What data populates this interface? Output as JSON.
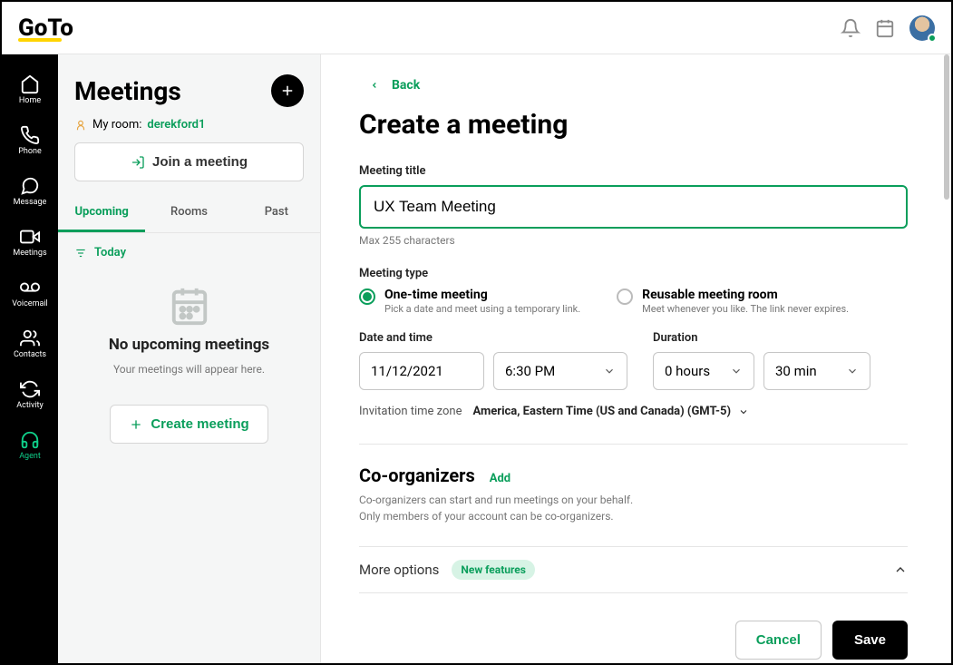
{
  "brand": "GoTo",
  "sidebar": [
    {
      "label": "Home"
    },
    {
      "label": "Phone"
    },
    {
      "label": "Message"
    },
    {
      "label": "Meetings"
    },
    {
      "label": "Voicemail"
    },
    {
      "label": "Contacts"
    },
    {
      "label": "Activity"
    },
    {
      "label": "Agent"
    }
  ],
  "middle": {
    "title": "Meetings",
    "myroom_label": "My room:",
    "myroom_id": "derekford1",
    "join_label": "Join a meeting",
    "tabs": [
      "Upcoming",
      "Rooms",
      "Past"
    ],
    "today_label": "Today",
    "empty_title": "No upcoming meetings",
    "empty_sub": "Your meetings will appear here.",
    "create_label": "Create meeting"
  },
  "form": {
    "back_label": "Back",
    "page_title": "Create a meeting",
    "title_label": "Meeting title",
    "title_value": "UX Team Meeting",
    "title_hint": "Max 255 characters",
    "type_label": "Meeting type",
    "type_options": [
      {
        "title": "One-time meeting",
        "desc": "Pick a date and meet using a temporary link."
      },
      {
        "title": "Reusable meeting room",
        "desc": "Meet whenever you like. The link never expires."
      }
    ],
    "date_label": "Date and time",
    "date_value": "11/12/2021",
    "time_value": "6:30 PM",
    "duration_label": "Duration",
    "hours_value": "0 hours",
    "minutes_value": "30 min",
    "tz_label": "Invitation time zone",
    "tz_value": "America, Eastern Time (US and Canada) (GMT-5)",
    "coorg_title": "Co-organizers",
    "coorg_add": "Add",
    "coorg_desc1": "Co-organizers can start and run meetings on your behalf.",
    "coorg_desc2": "Only members of your account can be co-organizers.",
    "more_label": "More options",
    "badge_label": "New features",
    "cancel_label": "Cancel",
    "save_label": "Save"
  }
}
